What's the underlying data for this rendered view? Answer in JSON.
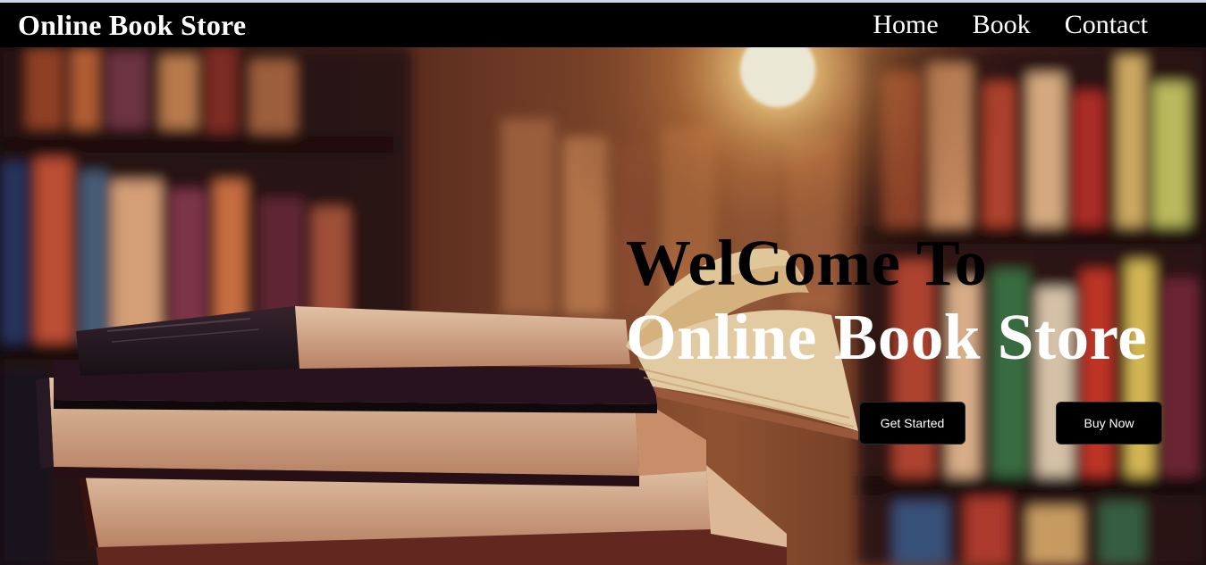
{
  "navbar": {
    "brand": "Online Book Store",
    "links": [
      {
        "label": "Home"
      },
      {
        "label": "Book"
      },
      {
        "label": "Contact"
      }
    ]
  },
  "hero": {
    "heading_line1": "WelCome To",
    "heading_line2": "Online Book Store",
    "buttons": {
      "get_started": "Get Started",
      "buy_now": "Buy Now"
    }
  },
  "colors": {
    "navbar_bg": "#000000",
    "button_bg": "#000000",
    "heading_line1": "#000000",
    "heading_line2": "#ffffff"
  }
}
